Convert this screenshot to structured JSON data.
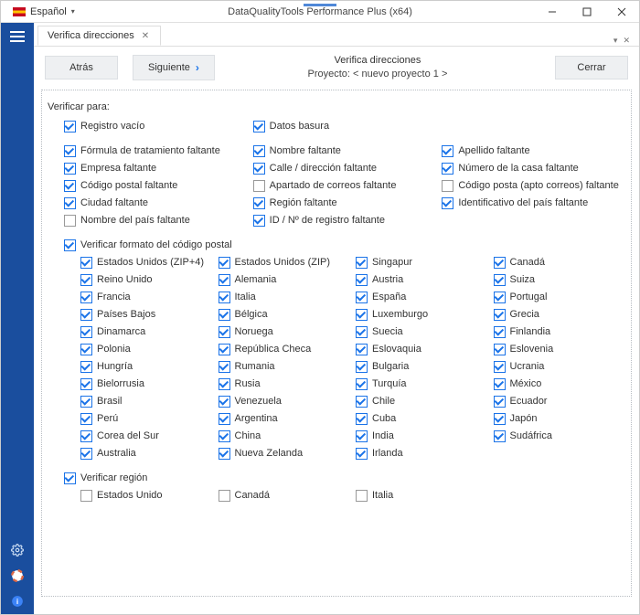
{
  "language": "Español",
  "app_title": "DataQualityTools Performance Plus (x64)",
  "tab_label": "Verifica direcciones",
  "toolbar": {
    "back": "Atrás",
    "next": "Siguiente",
    "close": "Cerrar"
  },
  "header": {
    "title": "Verifica direcciones",
    "project_prefix": "Proyecto: ",
    "project_name": "< nuevo proyecto 1 >"
  },
  "verify_for_title": "Verificar para:",
  "top_pair": [
    {
      "label": "Registro vacío",
      "checked": true
    },
    {
      "label": "Datos basura",
      "checked": true
    }
  ],
  "field_checks": [
    {
      "label": "Fórmula de tratamiento faltante",
      "checked": true
    },
    {
      "label": "Nombre faltante",
      "checked": true
    },
    {
      "label": "Apellido faltante",
      "checked": true
    },
    {
      "label": "Empresa faltante",
      "checked": true
    },
    {
      "label": "Calle / dirección faltante",
      "checked": true
    },
    {
      "label": "Número de la casa faltante",
      "checked": true
    },
    {
      "label": "Código postal faltante",
      "checked": true
    },
    {
      "label": "Apartado de correos faltante",
      "checked": false
    },
    {
      "label": "Código posta (apto correos) faltante",
      "checked": false
    },
    {
      "label": "Ciudad faltante",
      "checked": true
    },
    {
      "label": "Región faltante",
      "checked": true
    },
    {
      "label": "Identificativo del país faltante",
      "checked": true
    },
    {
      "label": "Nombre del país faltante",
      "checked": false
    },
    {
      "label": "ID / Nº de registro faltante",
      "checked": true
    }
  ],
  "zip_title": "Verificar formato del código postal",
  "zip_checked": true,
  "zip_countries": [
    {
      "label": "Estados Unidos (ZIP+4)",
      "checked": true
    },
    {
      "label": "Estados Unidos (ZIP)",
      "checked": true
    },
    {
      "label": "Singapur",
      "checked": true
    },
    {
      "label": "Canadá",
      "checked": true
    },
    {
      "label": "Reino Unido",
      "checked": true
    },
    {
      "label": "Alemania",
      "checked": true
    },
    {
      "label": "Austria",
      "checked": true
    },
    {
      "label": "Suiza",
      "checked": true
    },
    {
      "label": "Francia",
      "checked": true
    },
    {
      "label": "Italia",
      "checked": true
    },
    {
      "label": "España",
      "checked": true
    },
    {
      "label": "Portugal",
      "checked": true
    },
    {
      "label": "Países Bajos",
      "checked": true
    },
    {
      "label": "Bélgica",
      "checked": true
    },
    {
      "label": "Luxemburgo",
      "checked": true
    },
    {
      "label": "Grecia",
      "checked": true
    },
    {
      "label": "Dinamarca",
      "checked": true
    },
    {
      "label": "Noruega",
      "checked": true
    },
    {
      "label": "Suecia",
      "checked": true
    },
    {
      "label": "Finlandia",
      "checked": true
    },
    {
      "label": "Polonia",
      "checked": true
    },
    {
      "label": "República Checa",
      "checked": true
    },
    {
      "label": "Eslovaquia",
      "checked": true
    },
    {
      "label": "Eslovenia",
      "checked": true
    },
    {
      "label": "Hungría",
      "checked": true
    },
    {
      "label": "Rumania",
      "checked": true
    },
    {
      "label": "Bulgaria",
      "checked": true
    },
    {
      "label": "Ucrania",
      "checked": true
    },
    {
      "label": "Bielorrusia",
      "checked": true
    },
    {
      "label": "Rusia",
      "checked": true
    },
    {
      "label": "Turquía",
      "checked": true
    },
    {
      "label": "México",
      "checked": true
    },
    {
      "label": "Brasil",
      "checked": true
    },
    {
      "label": "Venezuela",
      "checked": true
    },
    {
      "label": "Chile",
      "checked": true
    },
    {
      "label": "Ecuador",
      "checked": true
    },
    {
      "label": "Perú",
      "checked": true
    },
    {
      "label": "Argentina",
      "checked": true
    },
    {
      "label": "Cuba",
      "checked": true
    },
    {
      "label": "Japón",
      "checked": true
    },
    {
      "label": "Corea del Sur",
      "checked": true
    },
    {
      "label": "China",
      "checked": true
    },
    {
      "label": "India",
      "checked": true
    },
    {
      "label": "Sudáfrica",
      "checked": true
    },
    {
      "label": "Australia",
      "checked": true
    },
    {
      "label": "Nueva Zelanda",
      "checked": true
    },
    {
      "label": "Irlanda",
      "checked": true
    }
  ],
  "region_title": "Verificar región",
  "region_checked": true,
  "region_countries": [
    {
      "label": "Estados Unido",
      "checked": false
    },
    {
      "label": "Canadá",
      "checked": false
    },
    {
      "label": "Italia",
      "checked": false
    }
  ]
}
